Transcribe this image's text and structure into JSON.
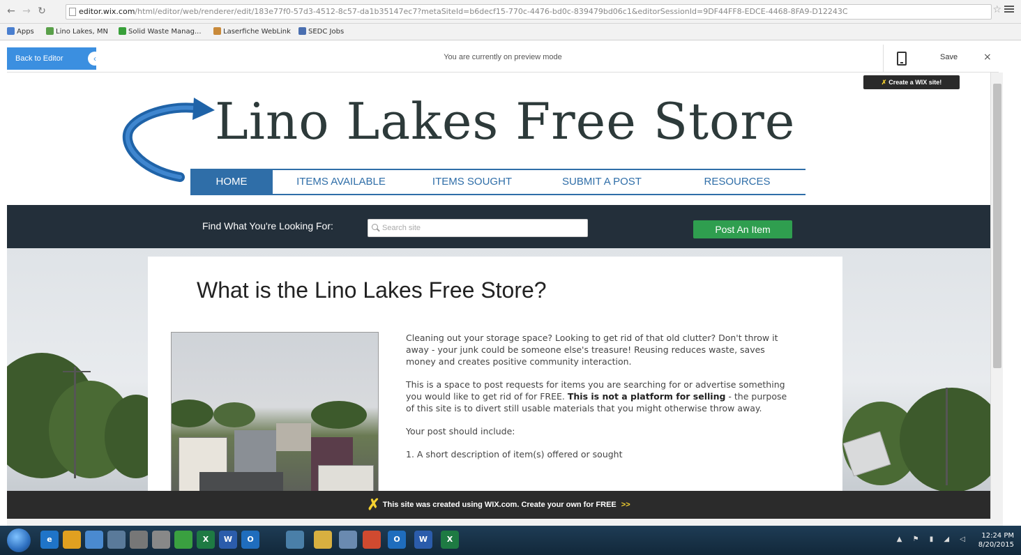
{
  "browser": {
    "url_host": "editor.wix.com",
    "url_path": "/html/editor/web/renderer/edit/183e77f0-57d3-4512-8c57-da1b35147ec7?metaSiteId=b6decf15-770c-4476-bd0c-839479bd06c1&editorSessionId=9DF44FF8-EDCE-4468-8FA9-D12243C",
    "star_glyph": "☆",
    "bookmarks": [
      {
        "label": "Apps",
        "color": "#4a7fcf"
      },
      {
        "label": "Lino Lakes, MN",
        "color": "#5aa04a"
      },
      {
        "label": "Solid Waste Manag...",
        "color": "#39a03a"
      },
      {
        "label": "Laserfiche WebLink",
        "color": "#c98a3a"
      },
      {
        "label": "SEDC Jobs",
        "color": "#4a6fb0"
      }
    ]
  },
  "wix_bar": {
    "back_label": "Back to Editor",
    "back_chevron": "‹",
    "preview_message": "You are currently on preview mode",
    "save_label": "Save",
    "close_glyph": "×",
    "create_tag": "Create a WIX site!",
    "x_glyph": "✗"
  },
  "site": {
    "title": "Lino Lakes Free Store",
    "nav": [
      {
        "label": "HOME",
        "active": true
      },
      {
        "label": "ITEMS AVAILABLE",
        "active": false
      },
      {
        "label": "ITEMS SOUGHT",
        "active": false
      },
      {
        "label": "SUBMIT A POST",
        "active": false
      },
      {
        "label": "RESOURCES",
        "active": false
      }
    ],
    "find_label": "Find What You're Looking For:",
    "search_placeholder": "Search site",
    "post_button": "Post An Item",
    "heading": "What is the Lino Lakes Free Store?",
    "para1": "Cleaning out your storage space? Looking to get rid of that old clutter? Don't throw it away - your junk could be someone else's treasure! Reusing reduces waste, saves money and creates positive community interaction.",
    "para2_a": "This is a space to post requests for items you are searching for or advertise something you would like to get rid of for FREE. ",
    "para2_bold": "This is not a platform for selling",
    "para2_b": " - the purpose of this site is to divert still usable materials that you might otherwise throw away.",
    "para3": "Your post should include:",
    "para4": "1. A short description of item(s) offered or sought"
  },
  "footer": {
    "text_a": "This site was created using ",
    "text_brand": "WIX.com",
    "text_b": ". Create your own for FREE ",
    "chevrons": ">>"
  },
  "taskbar": {
    "time": "12:24 PM",
    "date": "8/20/2015",
    "icons": [
      {
        "name": "ie-icon",
        "label": "e",
        "color": "#1f74c8"
      },
      {
        "name": "chrome-icon",
        "label": "",
        "color": "#e0a020"
      },
      {
        "name": "window-icon",
        "label": "",
        "color": "#4a8ad0"
      },
      {
        "name": "display-icon",
        "label": "",
        "color": "#5a7a9a"
      },
      {
        "name": "stapler-icon",
        "label": "",
        "color": "#777"
      },
      {
        "name": "gun-icon",
        "label": "",
        "color": "#888"
      },
      {
        "name": "tree-icon",
        "label": "",
        "color": "#3aa040"
      },
      {
        "name": "excel-icon",
        "label": "X",
        "color": "#1e7a43"
      },
      {
        "name": "word-icon",
        "label": "W",
        "color": "#2b5cab"
      },
      {
        "name": "outlook-icon",
        "label": "O",
        "color": "#1f6dbd"
      },
      {
        "name": "search-app-icon",
        "label": "",
        "color": "#4a7fa8"
      },
      {
        "name": "explorer-icon",
        "label": "",
        "color": "#d8b040"
      },
      {
        "name": "calculator-icon",
        "label": "",
        "color": "#6a8ab0"
      },
      {
        "name": "chrome-task-icon",
        "label": "",
        "color": "#d04a30"
      },
      {
        "name": "outlook-task-icon",
        "label": "O",
        "color": "#1f6dbd"
      },
      {
        "name": "word-task-icon",
        "label": "W",
        "color": "#2b5cab"
      },
      {
        "name": "excel-task-icon",
        "label": "X",
        "color": "#1e7a43"
      }
    ]
  },
  "colors": {
    "brand_blue": "#2f6ea8",
    "post_green": "#2f9e4f",
    "strip_dark": "#232f3a",
    "wix_blue": "#3b8fe0"
  }
}
